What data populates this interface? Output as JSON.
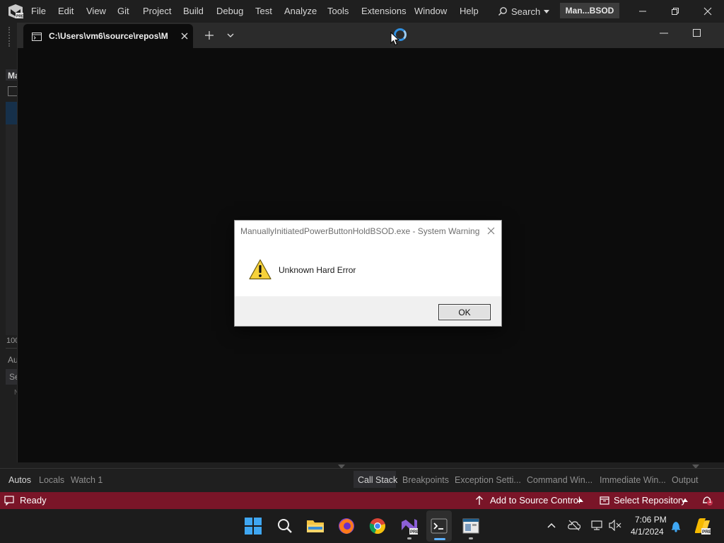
{
  "menu": {
    "items": [
      "File",
      "Edit",
      "View",
      "Git",
      "Project",
      "Build",
      "Debug",
      "Test",
      "Analyze",
      "Tools",
      "Extensions",
      "Window",
      "Help"
    ],
    "search_label": "Search",
    "solution_name": "Man...BSOD"
  },
  "left_strip": {
    "title_frag": "Ma",
    "zoom_frag": "100",
    "autos_frag": "Au",
    "search_frag": "Se",
    "name_frag": "N"
  },
  "terminal": {
    "tab_title": "C:\\Users\\vm6\\source\\repos\\M"
  },
  "bottom_tabs": {
    "left": [
      "Autos",
      "Locals",
      "Watch 1"
    ],
    "right": [
      "Call Stack",
      "Breakpoints",
      "Exception Setti...",
      "Command Win...",
      "Immediate Win...",
      "Output"
    ]
  },
  "status": {
    "ready": "Ready",
    "source_control": "Add to Source Control",
    "repository": "Select Repository",
    "notification_count": "1"
  },
  "taskbar": {
    "time": "7:06 PM",
    "date": "4/1/2024"
  },
  "dialog": {
    "title": "ManuallyInitiatedPowerButtonHoldBSOD.exe - System Warning",
    "message": "Unknown Hard Error",
    "ok_label": "OK"
  },
  "colors": {
    "status_bar": "#7a1528",
    "accent_blue": "#2f8fe0"
  }
}
